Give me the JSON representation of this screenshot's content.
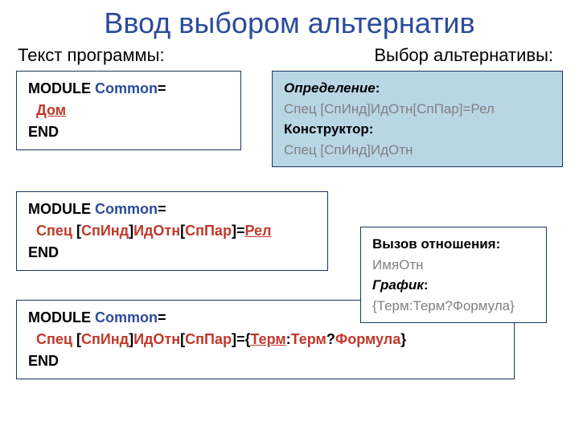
{
  "title": "Ввод выбором альтернатив",
  "labels": {
    "program": "Текст программы:",
    "choice": "Выбор альтернативы:"
  },
  "box_a": {
    "l1_kw": "MODULE ",
    "l1_name": "Common",
    "l1_eq": "=",
    "l2": "Дом",
    "l3": "END"
  },
  "box_b": {
    "def_label": "Определение",
    "def_colon": ":",
    "def_body": "Спец [СпИнд]ИдОтн[СпПар]=Рел",
    "ctor_label": "Конструктор:",
    "ctor_body": "Спец [СпИнд]ИдОтн"
  },
  "box_c": {
    "l1_kw": "MODULE ",
    "l1_name": "Common",
    "l1_eq": "=",
    "l2_a": "Спец ",
    "l2_b": "[",
    "l2_c": "СпИнд",
    "l2_d": "]",
    "l2_e": "ИдОтн",
    "l2_f": "[",
    "l2_g": "СпПар",
    "l2_h": "]=",
    "l2_i": "Рел",
    "l3": "END"
  },
  "box_d": {
    "call_label": "Вызов отношения:",
    "call_body": "ИмяОтн",
    "graf_label": "График",
    "graf_colon": ":",
    "graf_body": "{Терм:Терм?Формула}"
  },
  "box_e": {
    "l1_kw": "MODULE ",
    "l1_name": "Common",
    "l1_eq": "=",
    "l2_a": "Спец ",
    "l2_b": "[",
    "l2_c": "СпИнд",
    "l2_d": "]",
    "l2_e": "ИдОтн",
    "l2_f": "[",
    "l2_g": "СпПар",
    "l2_h": "]={",
    "l2_i": "Терм",
    "l2_j": ":",
    "l2_k": "Терм",
    "l2_l": "?",
    "l2_m": "Формула",
    "l2_n": "}",
    "l3": "END"
  }
}
